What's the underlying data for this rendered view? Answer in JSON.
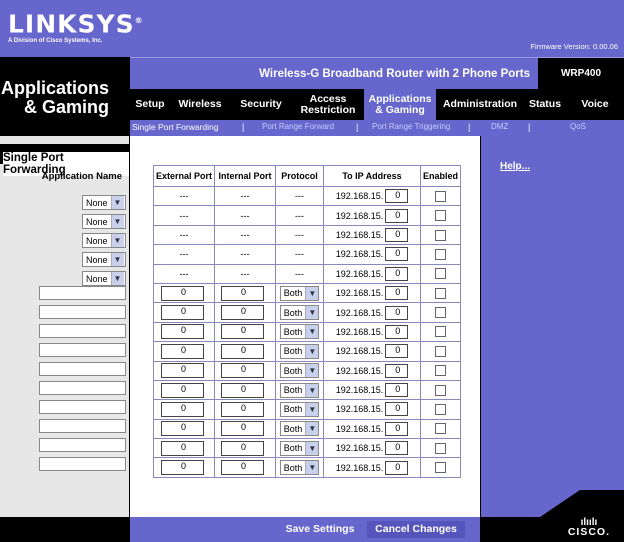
{
  "brand": {
    "logo_text": "LINKSYS",
    "logo_sup": "®",
    "logo_sub": "A Division of Cisco Systems, Inc.",
    "firmware": "Firmware Version: 0.00.06"
  },
  "page_title_line1": "Applications",
  "page_title_line2": "& Gaming",
  "product": {
    "name": "Wireless-G Broadband Router with 2 Phone Ports",
    "model": "WRP400"
  },
  "main_nav": [
    {
      "label": "Setup",
      "active": false
    },
    {
      "label": "Wireless",
      "active": false
    },
    {
      "label": "Security",
      "active": false
    },
    {
      "label": "Access\nRestriction",
      "active": false
    },
    {
      "label": "Applications\n& Gaming",
      "active": true
    },
    {
      "label": "Administration",
      "active": false
    },
    {
      "label": "Status",
      "active": false
    },
    {
      "label": "Voice",
      "active": false
    }
  ],
  "sub_nav": [
    {
      "label": "Single Port Forwarding",
      "active": true
    },
    {
      "label": "Port Range Forward",
      "active": false
    },
    {
      "label": "Port Range Triggering",
      "active": false
    },
    {
      "label": "DMZ",
      "active": false
    },
    {
      "label": "QoS",
      "active": false
    }
  ],
  "sub_nav_separator": "|",
  "section_title": "Single Port Forwarding",
  "app_name_label": "Application Name",
  "help_link": "Help...",
  "table": {
    "headers": [
      "External Port",
      "Internal Port",
      "Protocol",
      "To IP Address",
      "Enabled"
    ],
    "ip_prefix": "192.168.15.",
    "predefined_rows": [
      {
        "app": "None",
        "external": "---",
        "internal": "---",
        "protocol": "---",
        "ip_last": "0",
        "enabled": false
      },
      {
        "app": "None",
        "external": "---",
        "internal": "---",
        "protocol": "---",
        "ip_last": "0",
        "enabled": false
      },
      {
        "app": "None",
        "external": "---",
        "internal": "---",
        "protocol": "---",
        "ip_last": "0",
        "enabled": false
      },
      {
        "app": "None",
        "external": "---",
        "internal": "---",
        "protocol": "---",
        "ip_last": "0",
        "enabled": false
      },
      {
        "app": "None",
        "external": "---",
        "internal": "---",
        "protocol": "---",
        "ip_last": "0",
        "enabled": false
      }
    ],
    "custom_rows": [
      {
        "app": "",
        "external": "0",
        "internal": "0",
        "protocol": "Both",
        "ip_last": "0",
        "enabled": false
      },
      {
        "app": "",
        "external": "0",
        "internal": "0",
        "protocol": "Both",
        "ip_last": "0",
        "enabled": false
      },
      {
        "app": "",
        "external": "0",
        "internal": "0",
        "protocol": "Both",
        "ip_last": "0",
        "enabled": false
      },
      {
        "app": "",
        "external": "0",
        "internal": "0",
        "protocol": "Both",
        "ip_last": "0",
        "enabled": false
      },
      {
        "app": "",
        "external": "0",
        "internal": "0",
        "protocol": "Both",
        "ip_last": "0",
        "enabled": false
      },
      {
        "app": "",
        "external": "0",
        "internal": "0",
        "protocol": "Both",
        "ip_last": "0",
        "enabled": false
      },
      {
        "app": "",
        "external": "0",
        "internal": "0",
        "protocol": "Both",
        "ip_last": "0",
        "enabled": false
      },
      {
        "app": "",
        "external": "0",
        "internal": "0",
        "protocol": "Both",
        "ip_last": "0",
        "enabled": false
      },
      {
        "app": "",
        "external": "0",
        "internal": "0",
        "protocol": "Both",
        "ip_last": "0",
        "enabled": false
      },
      {
        "app": "",
        "external": "0",
        "internal": "0",
        "protocol": "Both",
        "ip_last": "0",
        "enabled": false
      }
    ]
  },
  "buttons": {
    "save": "Save Settings",
    "cancel": "Cancel Changes"
  },
  "cisco": {
    "bars": "ılıılı",
    "word": "CISCO."
  },
  "colors": {
    "brand_purple": "#6666cc",
    "black": "#000000",
    "left_gray": "#e7e7e7"
  }
}
